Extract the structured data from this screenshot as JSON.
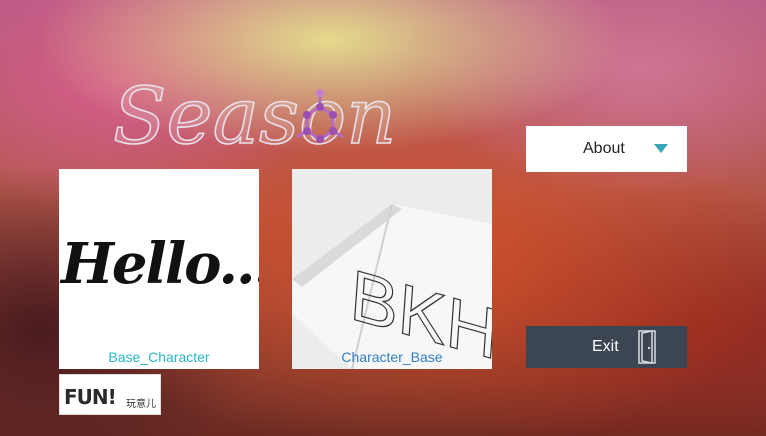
{
  "logo": {
    "text": "Season"
  },
  "about_button": {
    "label": "About",
    "icon": "chevron-down-icon",
    "chevron_color": "#3aa3b5"
  },
  "tiles": [
    {
      "image_text": "Hello...",
      "caption": "Base_Character"
    },
    {
      "image_text": "BKH",
      "caption": "Character_Base"
    }
  ],
  "exit_button": {
    "label": "Exit",
    "icon": "door-icon"
  },
  "brand": {
    "big": "FUN!",
    "small": "玩意儿"
  }
}
